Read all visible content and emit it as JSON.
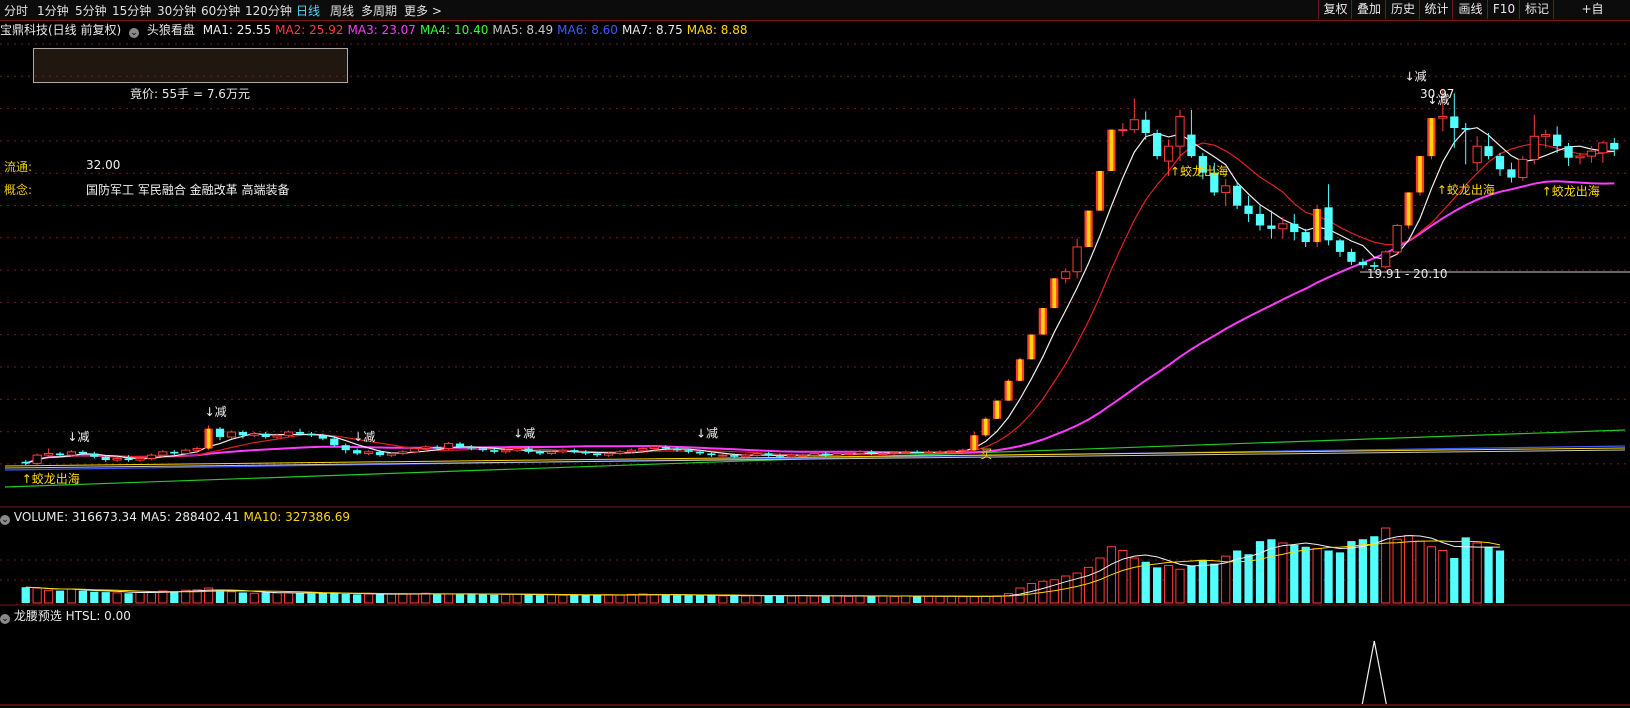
{
  "toolbar": {
    "timeframes": [
      "分时",
      "1分钟",
      "5分钟",
      "15分钟",
      "30分钟",
      "60分钟",
      "120分钟",
      "日线",
      "周线",
      "多周期",
      "更多 >"
    ],
    "active_timeframe": "日线",
    "right_buttons": [
      "复权",
      "叠加",
      "历史",
      "统计",
      "画线",
      "F10",
      "标记",
      "+自"
    ]
  },
  "header": {
    "stock": "宝鼎科技(日线 前复权)",
    "indicator": "头狼看盘",
    "ma": [
      {
        "label": "MA1: 25.55",
        "color": "#f0f0f0"
      },
      {
        "label": "MA2: 25.92",
        "color": "#ff3b3b"
      },
      {
        "label": "MA3: 23.07",
        "color": "#ff3bff"
      },
      {
        "label": "MA4: 10.40",
        "color": "#33ff33"
      },
      {
        "label": "MA5: 8.49",
        "color": "#c8c8c8"
      },
      {
        "label": "MA6: 8.60",
        "color": "#3b5bff"
      },
      {
        "label": "MA7: 8.75",
        "color": "#e8e8e8"
      },
      {
        "label": "MA8: 8.88",
        "color": "#ffd700"
      }
    ]
  },
  "auction": {
    "text": "竟价: 55手 = 7.6万元"
  },
  "info": {
    "float_label": "流通:",
    "float_value": "32.00",
    "concept_label": "概念:",
    "concept_value": "国防军工 军民融合 金融改革 高端装备"
  },
  "markers": {
    "dragon": "↑蛟龙出海",
    "reduce": "↓减",
    "buy": "买",
    "high_price": "30.97",
    "range_label": "19.91 - 20.10"
  },
  "volume_panel": {
    "title": "VOLUME: 316673.34",
    "ma5": "MA5: 288402.41",
    "ma10": "MA10: 327386.69"
  },
  "indicator_panel": {
    "title": "龙腰预选",
    "htsl": "HTSL: 0.00"
  },
  "colors": {
    "up": "#ff3b3b",
    "down": "#54ffff",
    "ma_white": "#f0f0f0",
    "ma_red": "#e02020",
    "ma_magenta": "#ff3bff",
    "ma_green": "#22cc22",
    "ma_blue": "#3b5bff",
    "ma_gold": "#ffd700",
    "grid": "#7a1a1a"
  },
  "chart_data": {
    "type": "candlestick",
    "price_axis": "unlabeled",
    "candles": [
      [
        8.5,
        8.6,
        8.3,
        8.4
      ],
      [
        8.4,
        9.0,
        8.3,
        8.9
      ],
      [
        8.9,
        9.3,
        8.8,
        9.0
      ],
      [
        9.0,
        9.1,
        8.8,
        8.9
      ],
      [
        8.9,
        9.2,
        8.8,
        9.1
      ],
      [
        9.1,
        9.2,
        8.9,
        9.0
      ],
      [
        9.0,
        9.1,
        8.7,
        8.8
      ],
      [
        8.8,
        8.9,
        8.5,
        8.6
      ],
      [
        8.6,
        8.8,
        8.5,
        8.7
      ],
      [
        8.7,
        8.9,
        8.5,
        8.6
      ],
      [
        8.6,
        8.8,
        8.5,
        8.7
      ],
      [
        8.7,
        9.0,
        8.6,
        8.9
      ],
      [
        8.9,
        9.2,
        8.8,
        9.1
      ],
      [
        9.1,
        9.2,
        8.9,
        9.0
      ],
      [
        9.0,
        9.3,
        8.9,
        9.2
      ],
      [
        9.2,
        9.4,
        9.0,
        9.3
      ],
      [
        9.3,
        10.7,
        9.2,
        10.5
      ],
      [
        10.5,
        10.6,
        9.8,
        10.0
      ],
      [
        10.0,
        10.4,
        9.9,
        10.3
      ],
      [
        10.3,
        10.4,
        9.9,
        10.1
      ],
      [
        10.1,
        10.3,
        10.0,
        10.2
      ],
      [
        10.2,
        10.3,
        9.9,
        10.0
      ],
      [
        10.0,
        10.2,
        9.9,
        10.1
      ],
      [
        10.1,
        10.4,
        10.0,
        10.3
      ],
      [
        10.3,
        10.5,
        10.1,
        10.2
      ],
      [
        10.2,
        10.3,
        10.0,
        10.1
      ],
      [
        10.1,
        10.2,
        9.8,
        9.9
      ],
      [
        9.9,
        10.0,
        9.4,
        9.5
      ],
      [
        9.5,
        9.6,
        9.0,
        9.2
      ],
      [
        9.2,
        9.3,
        8.9,
        9.0
      ],
      [
        9.0,
        9.2,
        8.9,
        9.1
      ],
      [
        9.1,
        9.2,
        8.8,
        8.9
      ],
      [
        8.9,
        9.1,
        8.8,
        9.0
      ],
      [
        9.0,
        9.2,
        8.9,
        9.1
      ],
      [
        9.1,
        9.4,
        9.0,
        9.3
      ],
      [
        9.3,
        9.5,
        9.1,
        9.4
      ],
      [
        9.4,
        9.5,
        9.2,
        9.3
      ],
      [
        9.3,
        9.7,
        9.2,
        9.6
      ],
      [
        9.6,
        9.7,
        9.3,
        9.4
      ],
      [
        9.4,
        9.5,
        9.2,
        9.3
      ],
      [
        9.3,
        9.4,
        9.1,
        9.2
      ],
      [
        9.2,
        9.3,
        9.0,
        9.1
      ],
      [
        9.1,
        9.3,
        9.0,
        9.2
      ],
      [
        9.2,
        9.4,
        9.1,
        9.3
      ],
      [
        9.3,
        9.4,
        9.0,
        9.1
      ],
      [
        9.1,
        9.2,
        8.9,
        9.0
      ],
      [
        9.0,
        9.2,
        8.9,
        9.1
      ],
      [
        9.1,
        9.3,
        9.0,
        9.2
      ],
      [
        9.2,
        9.3,
        9.0,
        9.1
      ],
      [
        9.1,
        9.2,
        8.9,
        9.0
      ],
      [
        9.0,
        9.1,
        8.8,
        8.9
      ],
      [
        8.9,
        9.1,
        8.8,
        9.0
      ],
      [
        9.0,
        9.2,
        8.9,
        9.1
      ],
      [
        9.1,
        9.3,
        9.0,
        9.2
      ],
      [
        9.2,
        9.4,
        9.1,
        9.3
      ],
      [
        9.3,
        9.5,
        9.2,
        9.4
      ],
      [
        9.4,
        9.5,
        9.2,
        9.3
      ],
      [
        9.3,
        9.4,
        9.1,
        9.2
      ],
      [
        9.2,
        9.3,
        9.0,
        9.1
      ],
      [
        9.1,
        9.2,
        8.9,
        9.0
      ],
      [
        9.0,
        9.1,
        8.8,
        8.9
      ],
      [
        8.9,
        9.0,
        8.8,
        8.9
      ],
      [
        8.9,
        9.0,
        8.7,
        8.8
      ],
      [
        8.8,
        9.0,
        8.7,
        8.9
      ],
      [
        8.9,
        9.1,
        8.8,
        9.0
      ],
      [
        9.0,
        9.1,
        8.8,
        8.9
      ],
      [
        8.9,
        9.0,
        8.7,
        8.8
      ],
      [
        8.8,
        9.0,
        8.7,
        8.9
      ],
      [
        8.9,
        9.0,
        8.8,
        8.9
      ],
      [
        8.9,
        9.1,
        8.8,
        9.0
      ],
      [
        9.0,
        9.1,
        8.8,
        8.9
      ],
      [
        8.9,
        9.0,
        8.8,
        9.0
      ],
      [
        9.0,
        9.1,
        8.9,
        9.0
      ],
      [
        9.0,
        9.2,
        8.9,
        9.1
      ],
      [
        9.1,
        9.2,
        8.9,
        9.0
      ],
      [
        9.0,
        9.1,
        8.9,
        9.0
      ],
      [
        9.0,
        9.1,
        8.9,
        9.05
      ],
      [
        9.05,
        9.2,
        9.0,
        9.1
      ],
      [
        9.1,
        9.2,
        9.0,
        9.05
      ],
      [
        9.05,
        9.2,
        9.0,
        9.1
      ],
      [
        9.1,
        9.2,
        9.0,
        9.1
      ],
      [
        9.1,
        9.2,
        9.0,
        9.15
      ],
      [
        9.15,
        9.3,
        9.1,
        9.2
      ],
      [
        9.2,
        10.3,
        9.1,
        10.1
      ],
      [
        10.1,
        11.2,
        10.0,
        11.1
      ],
      [
        11.1,
        12.2,
        11.1,
        12.2
      ],
      [
        12.2,
        13.5,
        12.2,
        13.4
      ],
      [
        13.4,
        14.8,
        13.4,
        14.7
      ],
      [
        14.7,
        16.2,
        14.7,
        16.2
      ],
      [
        16.2,
        17.8,
        16.2,
        17.8
      ],
      [
        17.8,
        19.6,
        17.8,
        19.6
      ],
      [
        19.6,
        20.2,
        19.3,
        20.0
      ],
      [
        20.0,
        22.0,
        19.6,
        21.5
      ],
      [
        21.5,
        23.7,
        21.5,
        23.7
      ],
      [
        23.7,
        26.1,
        23.7,
        26.1
      ],
      [
        26.1,
        28.6,
        26.1,
        28.6
      ],
      [
        28.6,
        29.0,
        28.2,
        28.6
      ],
      [
        28.6,
        30.5,
        28.4,
        29.2
      ],
      [
        29.2,
        29.7,
        28.0,
        28.4
      ],
      [
        28.4,
        28.6,
        26.8,
        27.0
      ],
      [
        26.7,
        28.0,
        25.8,
        27.6
      ],
      [
        27.6,
        29.8,
        26.7,
        29.4
      ],
      [
        28.3,
        29.8,
        26.9,
        27.0
      ],
      [
        27.0,
        27.2,
        25.6,
        26.0
      ],
      [
        26.0,
        26.6,
        24.6,
        24.8
      ],
      [
        24.8,
        25.6,
        24.0,
        25.2
      ],
      [
        25.2,
        25.4,
        23.8,
        24.0
      ],
      [
        24.0,
        24.6,
        23.0,
        23.5
      ],
      [
        23.5,
        24.0,
        22.5,
        22.8
      ],
      [
        22.8,
        23.7,
        22.0,
        22.6
      ],
      [
        22.6,
        23.3,
        22.0,
        22.9
      ],
      [
        22.9,
        23.5,
        21.9,
        22.4
      ],
      [
        22.4,
        22.6,
        21.5,
        21.8
      ],
      [
        21.8,
        24.0,
        21.5,
        23.8
      ],
      [
        23.9,
        25.3,
        21.6,
        21.9
      ],
      [
        21.9,
        22.0,
        20.9,
        21.2
      ],
      [
        21.2,
        21.4,
        20.4,
        20.6
      ],
      [
        20.6,
        20.8,
        20.2,
        20.4
      ],
      [
        20.4,
        20.6,
        20.1,
        20.3
      ],
      [
        20.3,
        21.3,
        20.2,
        21.2
      ],
      [
        21.2,
        22.9,
        21.0,
        22.8
      ],
      [
        22.8,
        24.8,
        22.6,
        24.8
      ],
      [
        24.8,
        27.0,
        24.6,
        27.0
      ],
      [
        27.0,
        29.3,
        26.8,
        29.3
      ],
      [
        29.3,
        31.0,
        28.5,
        29.4
      ],
      [
        29.4,
        30.8,
        27.5,
        28.7
      ],
      [
        28.7,
        29.0,
        26.5,
        28.6
      ],
      [
        26.6,
        28.2,
        26.1,
        27.6
      ],
      [
        27.6,
        28.4,
        26.8,
        27.0
      ],
      [
        27.0,
        27.2,
        25.8,
        26.2
      ],
      [
        26.2,
        26.6,
        25.4,
        25.7
      ],
      [
        25.7,
        27.0,
        25.5,
        26.8
      ],
      [
        26.8,
        29.5,
        26.5,
        28.2
      ],
      [
        28.2,
        28.6,
        27.5,
        28.3
      ],
      [
        28.3,
        28.8,
        27.2,
        27.6
      ],
      [
        27.6,
        27.8,
        26.4,
        26.9
      ],
      [
        26.9,
        27.2,
        26.5,
        27.0
      ],
      [
        27.0,
        27.6,
        26.6,
        27.3
      ],
      [
        27.2,
        27.9,
        26.6,
        27.8
      ],
      [
        27.8,
        28.1,
        27.0,
        27.4
      ]
    ],
    "volume": [
      42,
      40,
      34,
      33,
      37,
      33,
      30,
      29,
      27,
      26,
      28,
      30,
      32,
      31,
      34,
      35,
      40,
      33,
      30,
      28,
      26,
      28,
      27,
      27,
      26,
      25,
      28,
      26,
      24,
      23,
      24,
      23,
      24,
      25,
      24,
      26,
      23,
      24,
      24,
      25,
      23,
      22,
      23,
      24,
      22,
      21,
      22,
      21,
      22,
      21,
      20,
      22,
      21,
      23,
      24,
      22,
      22,
      21,
      21,
      20,
      20,
      19,
      20,
      19,
      20,
      19,
      20,
      19,
      20,
      19,
      18,
      19,
      18,
      19,
      18,
      19,
      18,
      19,
      18,
      18,
      18,
      18,
      17,
      17,
      18,
      19,
      25,
      40,
      52,
      58,
      62,
      72,
      80,
      95,
      120,
      150,
      140,
      120,
      110,
      95,
      100,
      90,
      100,
      115,
      105,
      125,
      140,
      130,
      165,
      170,
      160,
      155,
      150,
      145,
      140,
      135,
      165,
      170,
      178,
      200,
      170,
      180,
      165,
      150,
      140,
      120,
      175,
      160,
      150,
      140
    ],
    "htsl_spike_index": 118,
    "htsl": "0.00"
  }
}
